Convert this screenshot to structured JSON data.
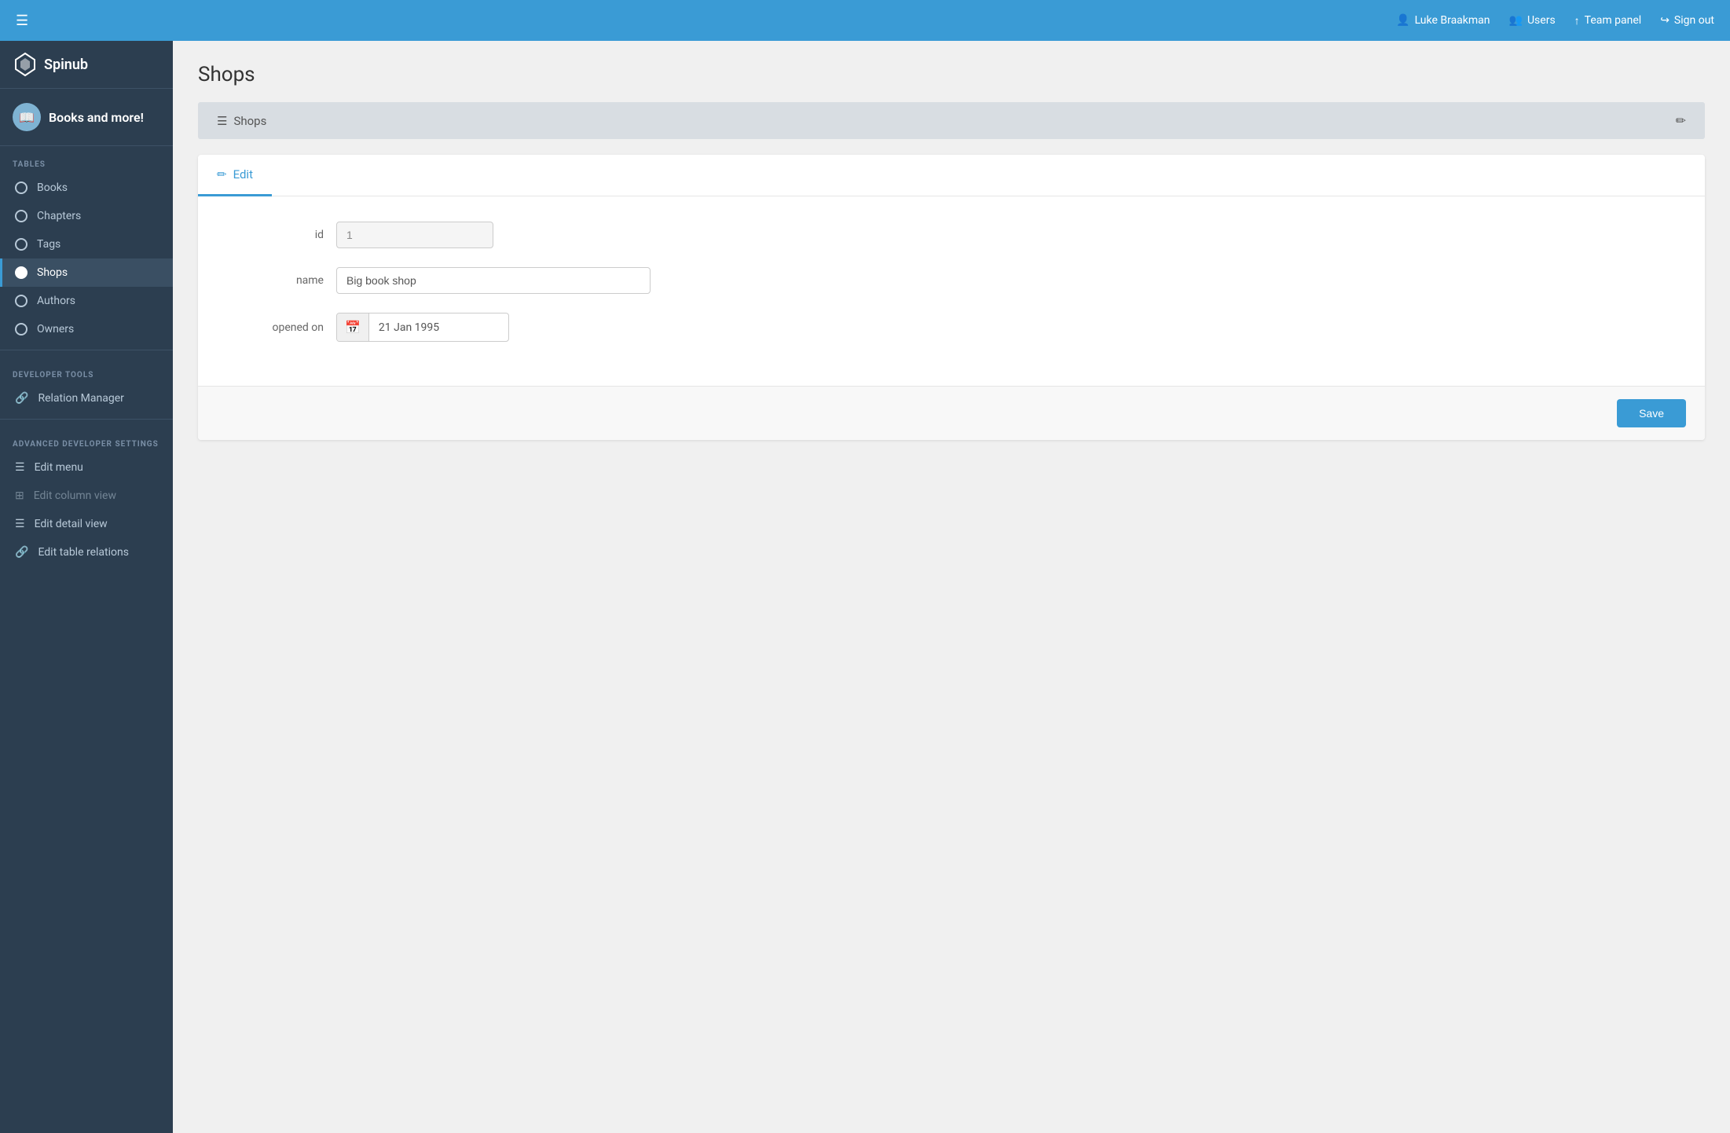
{
  "app": {
    "name": "Spinub"
  },
  "navbar": {
    "menu_icon": "☰",
    "user_icon": "👤",
    "users_icon": "👥",
    "team_icon": "↑",
    "signout_icon": "→",
    "user_label": "Luke Braakman",
    "users_label": "Users",
    "team_label": "Team panel",
    "signout_label": "Sign out"
  },
  "sidebar": {
    "brand_name": "Books and more!",
    "tables_label": "TABLES",
    "tables_items": [
      {
        "label": "Books",
        "active": false
      },
      {
        "label": "Chapters",
        "active": false
      },
      {
        "label": "Tags",
        "active": false
      },
      {
        "label": "Shops",
        "active": true
      },
      {
        "label": "Authors",
        "active": false
      },
      {
        "label": "Owners",
        "active": false
      }
    ],
    "developer_label": "DEVELOPER TOOLS",
    "developer_items": [
      {
        "label": "Relation Manager",
        "icon": "🔗"
      }
    ],
    "advanced_label": "ADVANCED DEVELOPER SETTINGS",
    "advanced_items": [
      {
        "label": "Edit menu",
        "icon": "☰",
        "disabled": false
      },
      {
        "label": "Edit column view",
        "icon": "⊞",
        "disabled": true
      },
      {
        "label": "Edit detail view",
        "icon": "☰",
        "disabled": false
      },
      {
        "label": "Edit table relations",
        "icon": "🔗",
        "disabled": false
      }
    ]
  },
  "page": {
    "title": "Shops"
  },
  "breadcrumb": {
    "list_icon": "☰",
    "shops_label": "Shops",
    "edit_icon": "✏"
  },
  "form": {
    "tab_label": "Edit",
    "tab_icon": "✏",
    "id_label": "id",
    "id_value": "1",
    "name_label": "name",
    "name_value": "Big book shop",
    "opened_label": "opened on",
    "calendar_icon": "📅",
    "opened_value": "21 Jan 1995",
    "save_label": "Save"
  }
}
